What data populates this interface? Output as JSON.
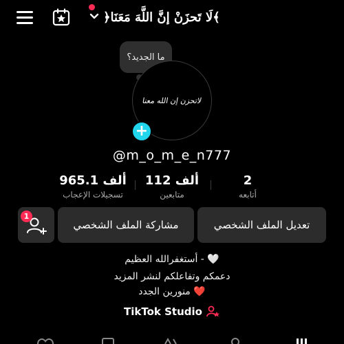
{
  "header": {
    "display_name": "﴿لَا تَحزَنْ إنَّ اللَّهَ مَعَنَا﴾",
    "menu_icon": "hamburger-menu-icon",
    "calendar_icon": "calendar-star-icon",
    "notification_dot_color": "#fe2c55"
  },
  "bubble": {
    "text": "ما الجديد؟"
  },
  "avatar": {
    "caption": "لاتحزن إن الله معنا"
  },
  "profile": {
    "username": "@m_o_m_e_n777"
  },
  "stats": [
    {
      "value": "2",
      "label": "أتابعه"
    },
    {
      "value": "112 ألف",
      "label": "متابعين"
    },
    {
      "value": "965.1 ألف",
      "label": "تسجيلات الإعجاب"
    }
  ],
  "buttons": {
    "edit_profile": "تعديل الملف الشخصي",
    "share_profile": "مشاركة الملف الشخصي",
    "add_friends_badge": "1"
  },
  "bio": {
    "line1": "أستغفرالله العظيم - 🤍",
    "line2": "دعمكم وتفاعلكم لنشر المزيد",
    "line3": "منورين الجدد ❤️"
  },
  "studio": {
    "label": "TikTok Studio"
  },
  "colors": {
    "accent_cyan": "#20d5ec",
    "accent_red": "#fe2c55",
    "button_bg": "#2c2c2c"
  }
}
